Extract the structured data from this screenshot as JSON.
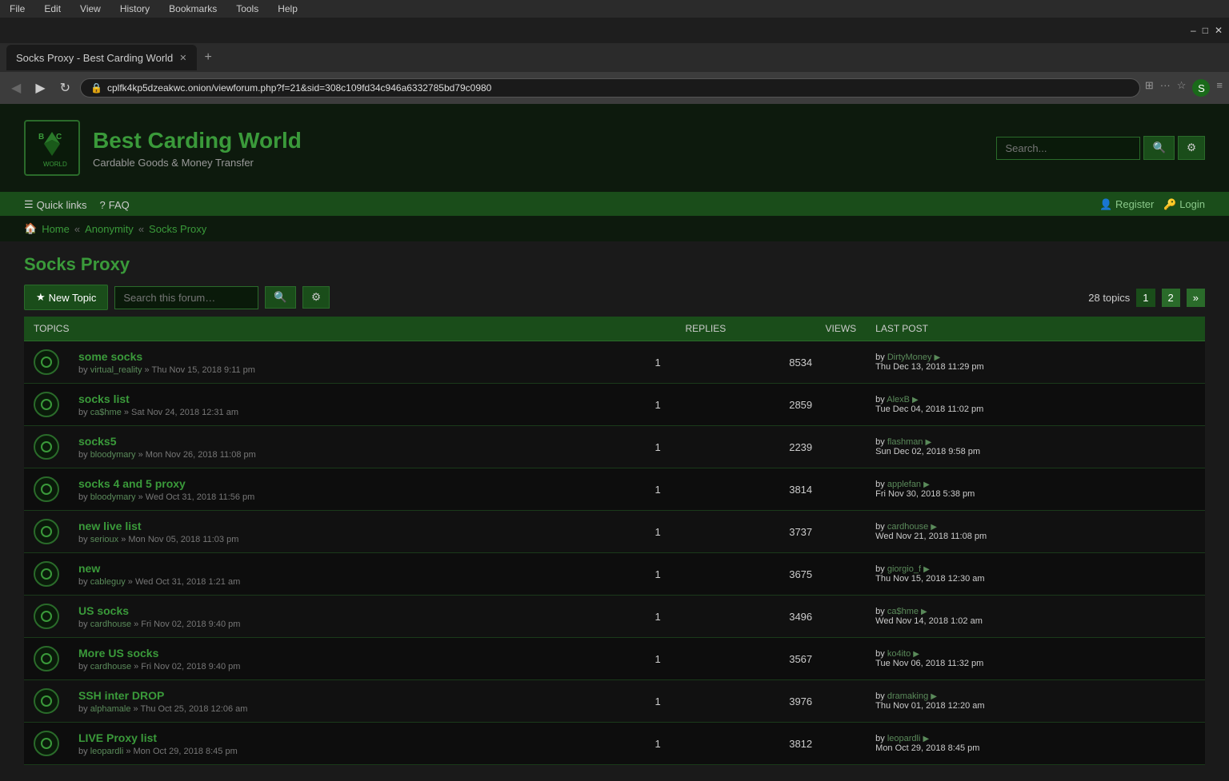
{
  "browser": {
    "menu_items": [
      "File",
      "Edit",
      "View",
      "History",
      "Bookmarks",
      "Tools",
      "Help"
    ],
    "tab_title": "Socks Proxy - Best Carding World",
    "url": "cplfk4kp5dzeakwc.onion/viewforum.php?f=21&sid=308c109fd34c946a6332785bd79c0980",
    "window_controls": [
      "–",
      "□",
      "✕"
    ]
  },
  "site": {
    "title": "Best Carding World",
    "tagline": "Cardable Goods & Money Transfer",
    "search_placeholder": "Search...",
    "search_btn": "🔍",
    "settings_btn": "⚙"
  },
  "nav": {
    "quick_links": "Quick links",
    "faq": "FAQ",
    "register": "Register",
    "login": "Login"
  },
  "breadcrumb": {
    "home": "Home",
    "anonymity": "Anonymity",
    "current": "Socks Proxy"
  },
  "forum": {
    "title": "Socks Proxy",
    "new_topic_label": "New Topic",
    "search_placeholder": "Search this forum…",
    "topics_count": "28 topics",
    "pagination": {
      "current": "1",
      "pages": [
        "1",
        "2"
      ],
      "next": "»"
    },
    "columns": {
      "topics": "TOPICS",
      "replies": "REPLIES",
      "views": "VIEWS",
      "last_post": "LAST POST"
    },
    "topics": [
      {
        "title": "some socks",
        "by": "virtual_reality",
        "date": "Thu Nov 15, 2018 9:11 pm",
        "replies": 1,
        "views": 8534,
        "last_by": "DirtyMoney",
        "last_date": "Thu Dec 13, 2018 11:29 pm"
      },
      {
        "title": "socks list",
        "by": "ca$hme",
        "date": "Sat Nov 24, 2018 12:31 am",
        "replies": 1,
        "views": 2859,
        "last_by": "AlexB",
        "last_date": "Tue Dec 04, 2018 11:02 pm"
      },
      {
        "title": "socks5",
        "by": "bloodymary",
        "date": "Mon Nov 26, 2018 11:08 pm",
        "replies": 1,
        "views": 2239,
        "last_by": "flashman",
        "last_date": "Sun Dec 02, 2018 9:58 pm"
      },
      {
        "title": "socks 4 and 5 proxy",
        "by": "bloodymary",
        "date": "Wed Oct 31, 2018 11:56 pm",
        "replies": 1,
        "views": 3814,
        "last_by": "applefan",
        "last_date": "Fri Nov 30, 2018 5:38 pm"
      },
      {
        "title": "new live list",
        "by": "serioux",
        "date": "Mon Nov 05, 2018 11:03 pm",
        "replies": 1,
        "views": 3737,
        "last_by": "cardhouse",
        "last_date": "Wed Nov 21, 2018 11:08 pm"
      },
      {
        "title": "new",
        "by": "cableguy",
        "date": "Wed Oct 31, 2018 1:21 am",
        "replies": 1,
        "views": 3675,
        "last_by": "giorgio_f",
        "last_date": "Thu Nov 15, 2018 12:30 am"
      },
      {
        "title": "US socks",
        "by": "cardhouse",
        "date": "Fri Nov 02, 2018 9:40 pm",
        "replies": 1,
        "views": 3496,
        "last_by": "ca$hme",
        "last_date": "Wed Nov 14, 2018 1:02 am"
      },
      {
        "title": "More US socks",
        "by": "cardhouse",
        "date": "Fri Nov 02, 2018 9:40 pm",
        "replies": 1,
        "views": 3567,
        "last_by": "ko4ito",
        "last_date": "Tue Nov 06, 2018 11:32 pm"
      },
      {
        "title": "SSH inter DROP",
        "by": "alphamale",
        "date": "Thu Oct 25, 2018 12:06 am",
        "replies": 1,
        "views": 3976,
        "last_by": "dramaking",
        "last_date": "Thu Nov 01, 2018 12:20 am"
      },
      {
        "title": "LIVE Proxy list",
        "by": "leopardli",
        "date": "Mon Oct 29, 2018 8:45 pm",
        "replies": 1,
        "views": 3812,
        "last_by": "leopardli",
        "last_date": "Mon Oct 29, 2018 8:45 pm"
      }
    ]
  }
}
